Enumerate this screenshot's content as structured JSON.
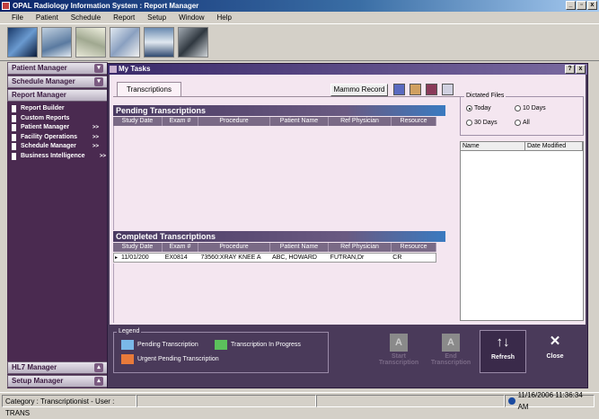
{
  "app": {
    "title": "OPAL Radiology Information System : Report Manager"
  },
  "menu": [
    "File",
    "Patient",
    "Schedule",
    "Report",
    "Setup",
    "Window",
    "Help"
  ],
  "window_controls": [
    "_",
    "▫",
    "x"
  ],
  "sidebar": {
    "sections": {
      "patient_manager": "Patient Manager",
      "schedule_manager": "Schedule Manager",
      "report_manager": "Report Manager",
      "hl7_manager": "HL7 Manager",
      "setup_manager": "Setup Manager"
    },
    "items": [
      {
        "label": "Report Builder",
        "arrow": ""
      },
      {
        "label": "Custom Reports",
        "arrow": ""
      },
      {
        "label": "Patient Manager",
        "arrow": ">>"
      },
      {
        "label": "Facility Operations",
        "arrow": ">>"
      },
      {
        "label": "Schedule Manager",
        "arrow": ">>"
      },
      {
        "label": "Business Intelligence",
        "arrow": ">>"
      }
    ]
  },
  "mytasks": {
    "title": "My Tasks",
    "tab": "Transcriptions",
    "mammo_button": "Mammo Record",
    "pending": {
      "title": "Pending Transcriptions",
      "columns": [
        "Study Date",
        "Exam #",
        "Procedure",
        "Patient Name",
        "Ref Physician",
        "Resource"
      ]
    },
    "completed": {
      "title": "Completed Transcriptions",
      "columns": [
        "Study Date",
        "Exam #",
        "Procedure",
        "Patient Name",
        "Ref Physician",
        "Resource"
      ],
      "rows": [
        [
          "11/01/200",
          "EX0814",
          "73560:XRAY KNEE A",
          "ABC, HOWARD",
          "FUTRAN,Dr",
          "CR"
        ]
      ]
    },
    "dictated_files": {
      "legend": "Dictated Files",
      "options": [
        "Today",
        "10 Days",
        "30 Days",
        "All"
      ],
      "selected": "Today",
      "columns": [
        "Name",
        "Date Modified"
      ]
    },
    "legend": {
      "title": "Legend",
      "items": [
        {
          "label": "Pending Transcription",
          "color": "#7ab8e8"
        },
        {
          "label": "Transcription In Progress",
          "color": "#5cc05c"
        },
        {
          "label": "Urgent Pending Transcription",
          "color": "#e87a3a"
        }
      ]
    },
    "actions": {
      "start": {
        "label": "Start Transcription",
        "glyph": "A"
      },
      "end": {
        "label": "End Transcription",
        "glyph": "A"
      },
      "refresh": {
        "label": "Refresh",
        "glyph": "↑↓"
      },
      "close": {
        "label": "Close",
        "glyph": "✕"
      }
    }
  },
  "status": {
    "category": "Category : Transcriptionist",
    "user": "User : TRANS",
    "datetime": "11/16/2006 11:36:34 AM"
  }
}
